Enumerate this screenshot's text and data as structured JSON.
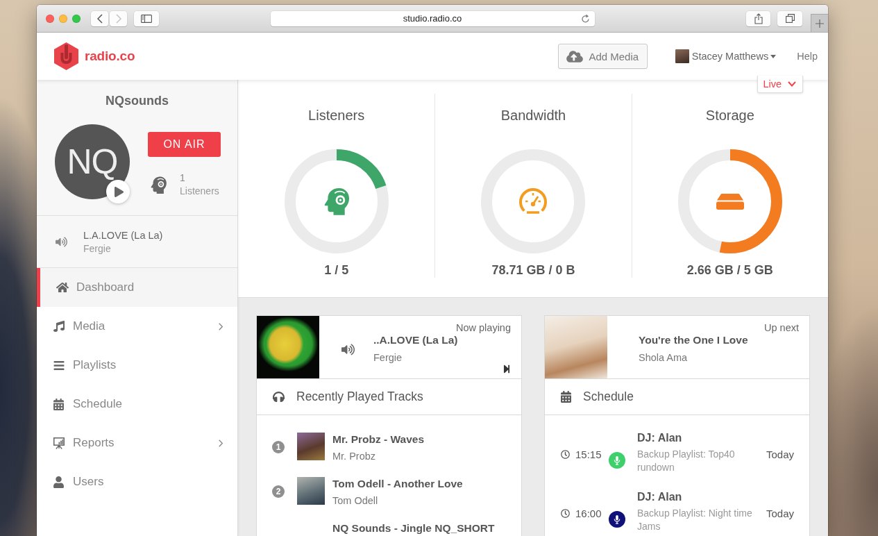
{
  "browser": {
    "url": "studio.radio.co"
  },
  "header": {
    "logo": "radio.co",
    "add_media": "Add Media",
    "user": "Stacey Matthews",
    "help": "Help"
  },
  "station": {
    "name": "NQsounds",
    "initials": "NQ",
    "on_air": "ON AIR",
    "listener_count": "1",
    "listener_label": "Listeners",
    "now_playing": {
      "title": "L.A.LOVE (La La)",
      "artist": "Fergie"
    }
  },
  "nav": [
    {
      "label": "Dashboard",
      "selected": true,
      "submenu": false
    },
    {
      "label": "Media",
      "selected": false,
      "submenu": true
    },
    {
      "label": "Playlists",
      "selected": false,
      "submenu": false
    },
    {
      "label": "Schedule",
      "selected": false,
      "submenu": false
    },
    {
      "label": "Reports",
      "selected": false,
      "submenu": true
    },
    {
      "label": "Users",
      "selected": false,
      "submenu": false
    }
  ],
  "live_menu": {
    "label": "Live"
  },
  "stats": [
    {
      "title": "Listeners",
      "value": "1 / 5",
      "level": 0.2,
      "color": "#3fa66a"
    },
    {
      "title": "Bandwidth",
      "value": "78.71 GB / 0 B",
      "level": 0,
      "color": "#f39c1f"
    },
    {
      "title": "Storage",
      "value": "2.66 GB / 5 GB",
      "level": 0.532,
      "color": "#f47c20"
    }
  ],
  "now_playing": {
    "label": "Now playing",
    "title": "..A.LOVE (La La)",
    "artist": "Fergie"
  },
  "up_next": {
    "label": "Up next",
    "title": "You're the One I Love",
    "artist": "Shola Ama"
  },
  "recent_tracks": {
    "title": "Recently Played Tracks",
    "items": [
      {
        "number": "1",
        "title": "Mr. Probz - Waves",
        "artist": "Mr. Probz"
      },
      {
        "number": "2",
        "title": "Tom Odell - Another Love",
        "artist": "Tom Odell"
      },
      {
        "title": "NQ Sounds - Jingle NQ_SHORT"
      }
    ]
  },
  "schedule": {
    "title": "Schedule",
    "items": [
      {
        "time": "15:15",
        "host": "DJ: Alan",
        "description": "Backup Playlist: Top40 rundown",
        "day": "Today",
        "color": "#3dd06b"
      },
      {
        "time": "16:00",
        "host": "DJ: Alan",
        "description": "Backup Playlist: Night time Jams",
        "day": "Today",
        "color": "#11117a"
      }
    ]
  }
}
